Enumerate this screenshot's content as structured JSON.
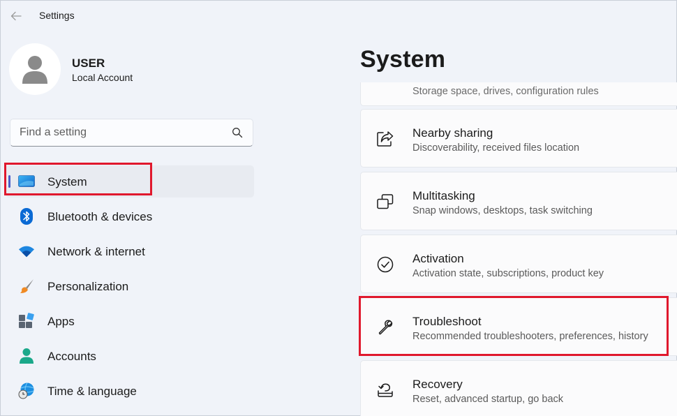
{
  "window": {
    "title": "Settings"
  },
  "profile": {
    "name": "USER",
    "account_type": "Local Account"
  },
  "search": {
    "placeholder": "Find a setting"
  },
  "nav": {
    "items": [
      {
        "label": "System",
        "icon": "system-monitor-icon",
        "selected": true
      },
      {
        "label": "Bluetooth & devices",
        "icon": "bluetooth-icon"
      },
      {
        "label": "Network & internet",
        "icon": "wifi-icon"
      },
      {
        "label": "Personalization",
        "icon": "paintbrush-icon"
      },
      {
        "label": "Apps",
        "icon": "apps-icon"
      },
      {
        "label": "Accounts",
        "icon": "accounts-icon"
      },
      {
        "label": "Time & language",
        "icon": "globe-clock-icon"
      }
    ]
  },
  "content": {
    "title": "System",
    "cards": [
      {
        "title": "",
        "subtitle": "Storage space, drives, configuration rules",
        "icon": "storage-icon"
      },
      {
        "title": "Nearby sharing",
        "subtitle": "Discoverability, received files location",
        "icon": "share-icon"
      },
      {
        "title": "Multitasking",
        "subtitle": "Snap windows, desktops, task switching",
        "icon": "multitasking-icon"
      },
      {
        "title": "Activation",
        "subtitle": "Activation state, subscriptions, product key",
        "icon": "check-circle-icon"
      },
      {
        "title": "Troubleshoot",
        "subtitle": "Recommended troubleshooters, preferences, history",
        "icon": "wrench-icon"
      },
      {
        "title": "Recovery",
        "subtitle": "Reset, advanced startup, go back",
        "icon": "recovery-icon"
      }
    ]
  },
  "colors": {
    "accent": "#4b5ec9",
    "highlight": "#e0182d",
    "background": "#f0f3f9",
    "card": "#fbfbfc"
  }
}
